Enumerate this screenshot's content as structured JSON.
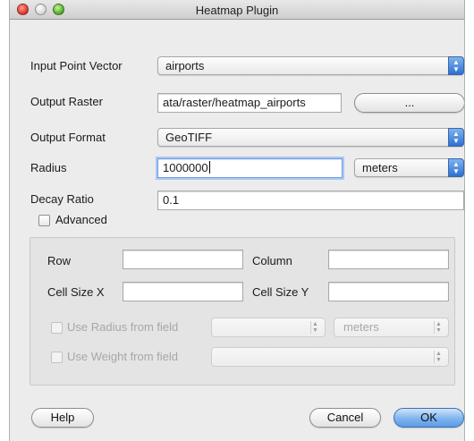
{
  "window": {
    "title": "Heatmap Plugin"
  },
  "input_point_vector": {
    "label": "Input Point Vector",
    "value": "airports"
  },
  "output_raster": {
    "label": "Output Raster",
    "value": "ata/raster/heatmap_airports",
    "browse_label": "..."
  },
  "output_format": {
    "label": "Output Format",
    "value": "GeoTIFF"
  },
  "radius": {
    "label": "Radius",
    "value": "1000000",
    "unit": "meters"
  },
  "decay_ratio": {
    "label": "Decay Ratio",
    "value": "0.1"
  },
  "advanced": {
    "checkbox_label": "Advanced",
    "row_label": "Row",
    "row_value": "",
    "column_label": "Column",
    "column_value": "",
    "cell_size_x_label": "Cell Size X",
    "cell_size_x_value": "",
    "cell_size_y_label": "Cell Size Y",
    "cell_size_y_value": "",
    "use_radius_label": "Use Radius from field",
    "radius_field_value": "",
    "radius_unit": "meters",
    "use_weight_label": "Use Weight from field",
    "weight_field_value": ""
  },
  "buttons": {
    "help": "Help",
    "cancel": "Cancel",
    "ok": "OK"
  },
  "colors": {
    "accent": "#5b9be7",
    "window_bg": "#ececec"
  }
}
